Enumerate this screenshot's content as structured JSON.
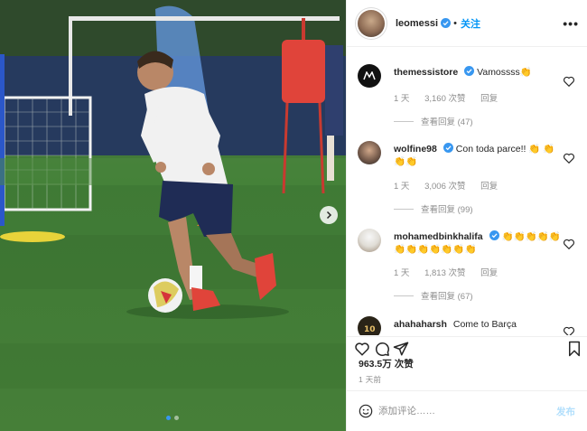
{
  "header": {
    "username": "leomessi",
    "follow_label": "关注",
    "more_label": "•••"
  },
  "comments": [
    {
      "username": "themessistore",
      "verified": true,
      "text": "Vamossss👏",
      "time": "1 天",
      "likes": "3,160 次赞",
      "reply": "回复",
      "view_replies": "查看回复 (47)"
    },
    {
      "username": "wolfine98",
      "verified": true,
      "text": "Con toda parce!! 👏 👏👏👏",
      "time": "1 天",
      "likes": "3,006 次赞",
      "reply": "回复",
      "view_replies": "查看回复 (99)"
    },
    {
      "username": "mohamedbinkhalifa",
      "verified": true,
      "text": "👏👏👏👏👏👏👏👏👏👏👏👏",
      "time": "1 天",
      "likes": "1,813 次赞",
      "reply": "回复",
      "view_replies": "查看回复 (67)"
    },
    {
      "username": "ahahaharsh",
      "verified": false,
      "text": "Come to Barça"
    }
  ],
  "post": {
    "likes": "963.5万 次赞",
    "time": "1 天前"
  },
  "add_comment": {
    "placeholder": "添加评论……",
    "post_label": "发布"
  },
  "icons": {
    "verified": "verified-badge-icon",
    "like": "heart-icon",
    "comment": "comment-bubble-icon",
    "share": "paper-plane-icon",
    "save": "bookmark-icon",
    "emoji": "smiley-icon",
    "next": "chevron-right-icon"
  },
  "colors": {
    "accent": "#0095f6",
    "verified": "#3897f0",
    "muted": "#8e8e8e"
  }
}
